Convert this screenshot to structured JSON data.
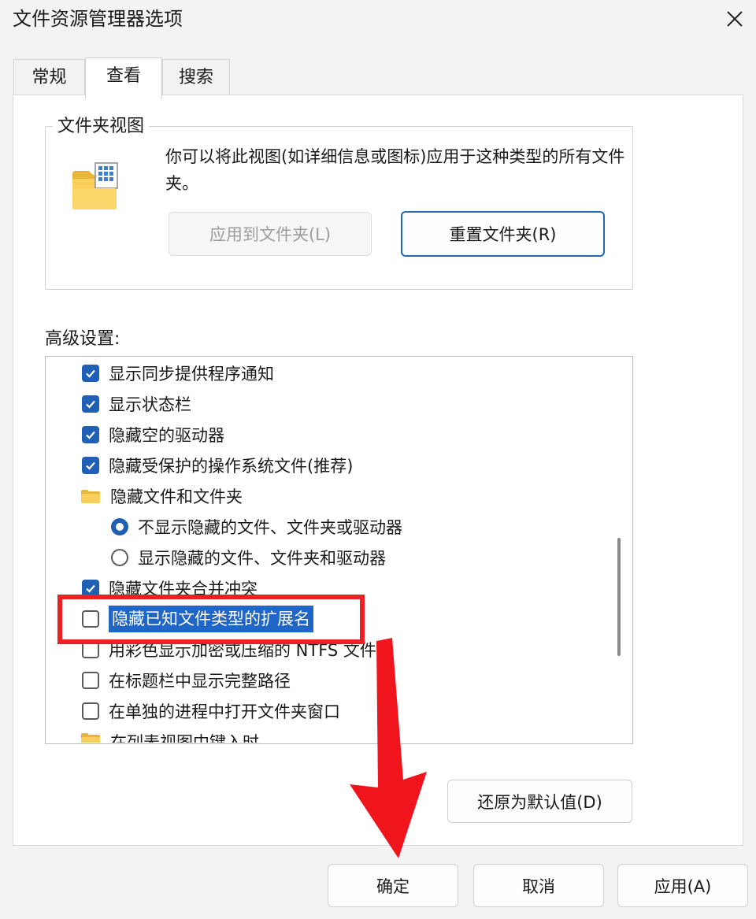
{
  "window": {
    "title": "文件资源管理器选项",
    "close_icon": "close-icon"
  },
  "tabs": [
    {
      "label": "常规",
      "active": false
    },
    {
      "label": "查看",
      "active": true
    },
    {
      "label": "搜索",
      "active": false
    }
  ],
  "folder_views": {
    "legend": "文件夹视图",
    "description": "你可以将此视图(如详细信息或图标)应用于这种类型的所有文件夹。",
    "apply_button": "应用到文件夹(L)",
    "reset_button": "重置文件夹(R)"
  },
  "advanced": {
    "label": "高级设置:",
    "items": [
      {
        "type": "checkbox",
        "checked": true,
        "label": "显示同步提供程序通知"
      },
      {
        "type": "checkbox",
        "checked": true,
        "label": "显示状态栏"
      },
      {
        "type": "checkbox",
        "checked": true,
        "label": "隐藏空的驱动器"
      },
      {
        "type": "checkbox",
        "checked": true,
        "label": "隐藏受保护的操作系统文件(推荐)"
      },
      {
        "type": "folder",
        "label": "隐藏文件和文件夹"
      },
      {
        "type": "radio",
        "checked": true,
        "label": "不显示隐藏的文件、文件夹或驱动器"
      },
      {
        "type": "radio",
        "checked": false,
        "label": "显示隐藏的文件、文件夹和驱动器"
      },
      {
        "type": "checkbox",
        "checked": true,
        "label": "隐藏文件夹合并冲突"
      },
      {
        "type": "checkbox",
        "checked": false,
        "label": "隐藏已知文件类型的扩展名",
        "selected": true
      },
      {
        "type": "checkbox",
        "checked": false,
        "label": "用彩色显示加密或压缩的 NTFS 文件"
      },
      {
        "type": "checkbox",
        "checked": false,
        "label": "在标题栏中显示完整路径"
      },
      {
        "type": "checkbox",
        "checked": false,
        "label": "在单独的进程中打开文件夹窗口"
      },
      {
        "type": "folder",
        "label": "在列表视图中键入时"
      }
    ],
    "restore_button": "还原为默认值(D)"
  },
  "footer": {
    "ok_button": "确定",
    "cancel_button": "取消",
    "apply_button": "应用(A)"
  },
  "colors": {
    "accent": "#1f5fb4",
    "selection": "#1f66c6",
    "annotation": "#ec1f25"
  }
}
